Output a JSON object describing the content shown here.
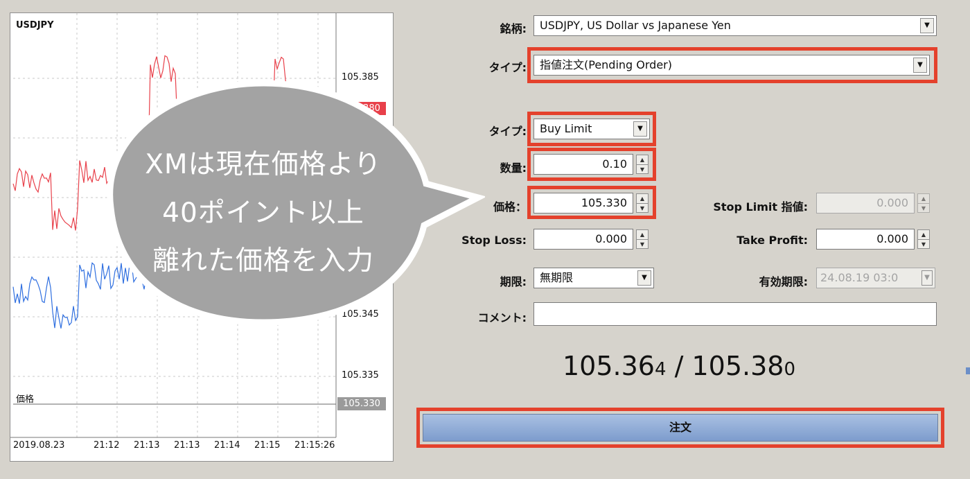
{
  "chart": {
    "symbol": "USDJPY",
    "price_label": "価格",
    "y_ticks": [
      "105.385",
      "105.345",
      "105.335"
    ],
    "ask_tag": "105.380",
    "price_tag": "105.330",
    "x_ticks": [
      "2019.08.23",
      "21:12",
      "21:13",
      "21:13",
      "21:14",
      "21:15",
      "21:15:26"
    ],
    "colors": {
      "ask_line": "#e8404a",
      "bid_line": "#2f6fe0",
      "price_tag_bg": "#9a9a9a",
      "ask_tag_bg": "#e8404a"
    }
  },
  "bubble": {
    "lines": [
      "XMは現在価格より",
      "40ポイント以上",
      "離れた価格を入力"
    ]
  },
  "form": {
    "symbol_label": "銘柄:",
    "symbol_value": "USDJPY, US Dollar vs Japanese Yen",
    "order_type_label": "タイプ:",
    "order_type_value": "指値注文(Pending Order)",
    "pending_type_label": "タイプ:",
    "pending_type_value": "Buy Limit",
    "volume_label": "数量:",
    "volume_value": "0.10",
    "price_label": "価格：",
    "price_value": "105.330",
    "stop_limit_label": "Stop Limit 指値:",
    "stop_limit_value": "0.000",
    "stop_loss_label": "Stop Loss:",
    "stop_loss_value": "0.000",
    "take_profit_label": "Take Profit:",
    "take_profit_value": "0.000",
    "expiry_label": "期限:",
    "expiry_value": "無期限",
    "expiry_date_label": "有効期限:",
    "expiry_date_value": "24.08.19 03:0",
    "comment_label": "コメント:",
    "comment_value": "",
    "highlight_color": "#e4412c"
  },
  "quote": {
    "bid_main": "105.36",
    "bid_small": "4",
    "separator": " / ",
    "ask_main": "105.38",
    "ask_small": "0"
  },
  "order_button": {
    "label": "注文"
  }
}
